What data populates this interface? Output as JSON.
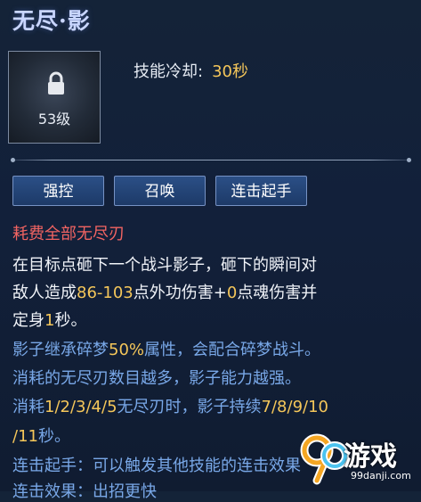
{
  "skill": {
    "title": "无尽·影",
    "level_label": "53级",
    "cooldown_label": "技能冷却:",
    "cooldown_value": "30秒",
    "icon": "lock-icon"
  },
  "tags": [
    "强控",
    "召唤",
    "连击起手"
  ],
  "cost": "耗费全部无尽刃",
  "desc": {
    "l1": "在目标点砸下一个战斗影子，砸下的瞬间对",
    "l2_a": "敌人造成",
    "l2_b": "86-103",
    "l2_c": "点外功伤害+",
    "l2_d": "0",
    "l2_e": "点魂伤害并",
    "l3_a": "定身",
    "l3_b": "1",
    "l3_c": "秒。",
    "l4_a": "影子继承碎梦",
    "l4_b": "50%",
    "l4_c": "属性，会配合碎梦战斗。",
    "l5": "消耗的无尽刃数目越多，影子能力越强。",
    "l6_a": "消耗",
    "l6_b": "1/2/3/4/5",
    "l6_c": "无尽刃时，影子持续",
    "l6_d": "7/8/9/10",
    "l7_a": "/11",
    "l7_b": "秒。",
    "l8": "连击起手：可以触发其他技能的连击效果",
    "l9": "连击效果：出招更快"
  },
  "watermark": {
    "text": "游戏",
    "sub": "99danji.com"
  }
}
